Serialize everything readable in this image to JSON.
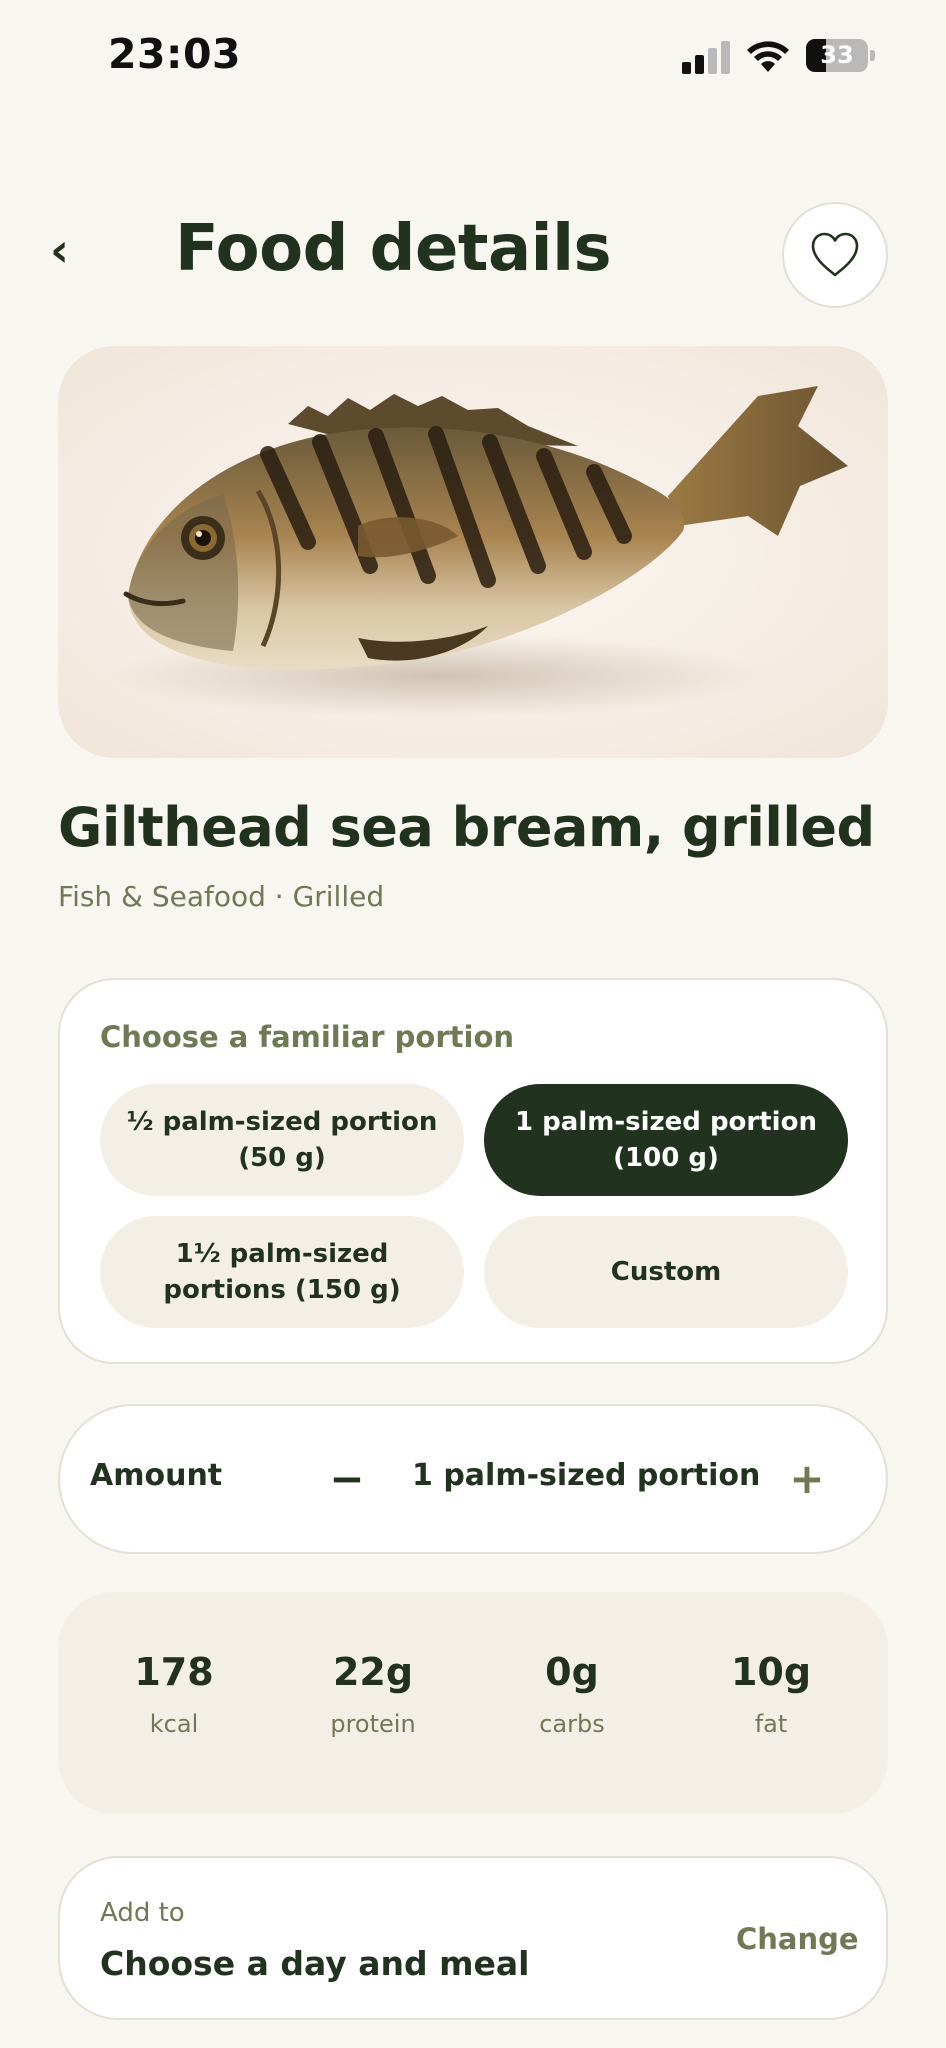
{
  "status_bar": {
    "time": "23:03",
    "battery_level": "33",
    "battery_fraction": 0.33
  },
  "header": {
    "back_icon": "chevron-left-icon",
    "back_glyph": "‹",
    "title": "Food details",
    "favorite_icon": "heart-outline-icon"
  },
  "food": {
    "name": "Gilthead sea bream, grilled",
    "category": "Fish & Seafood · Grilled"
  },
  "portion": {
    "heading": "Choose a familiar portion",
    "options": [
      {
        "label": "½ palm-sized portion (50 g)",
        "selected": false
      },
      {
        "label": "1 palm-sized portion (100 g)",
        "selected": true
      },
      {
        "label": "1½ palm-sized portions (150 g)",
        "selected": false
      },
      {
        "label": "Custom",
        "selected": false
      }
    ]
  },
  "amount": {
    "label": "Amount",
    "minus": "−",
    "value": "1 palm-sized portion",
    "plus": "+"
  },
  "nutrition": [
    {
      "value": "178",
      "label": "kcal"
    },
    {
      "value": "22g",
      "label": "protein"
    },
    {
      "value": "0g",
      "label": "carbs"
    },
    {
      "value": "10g",
      "label": "fat"
    }
  ],
  "add_to": {
    "label": "Add to",
    "value": "Choose a day and meal",
    "action": "Change"
  },
  "colors": {
    "background": "#f8f6f1",
    "primary_dark": "#21321f",
    "muted_olive": "#6f7a55",
    "chip_bg": "#f3efe6"
  }
}
